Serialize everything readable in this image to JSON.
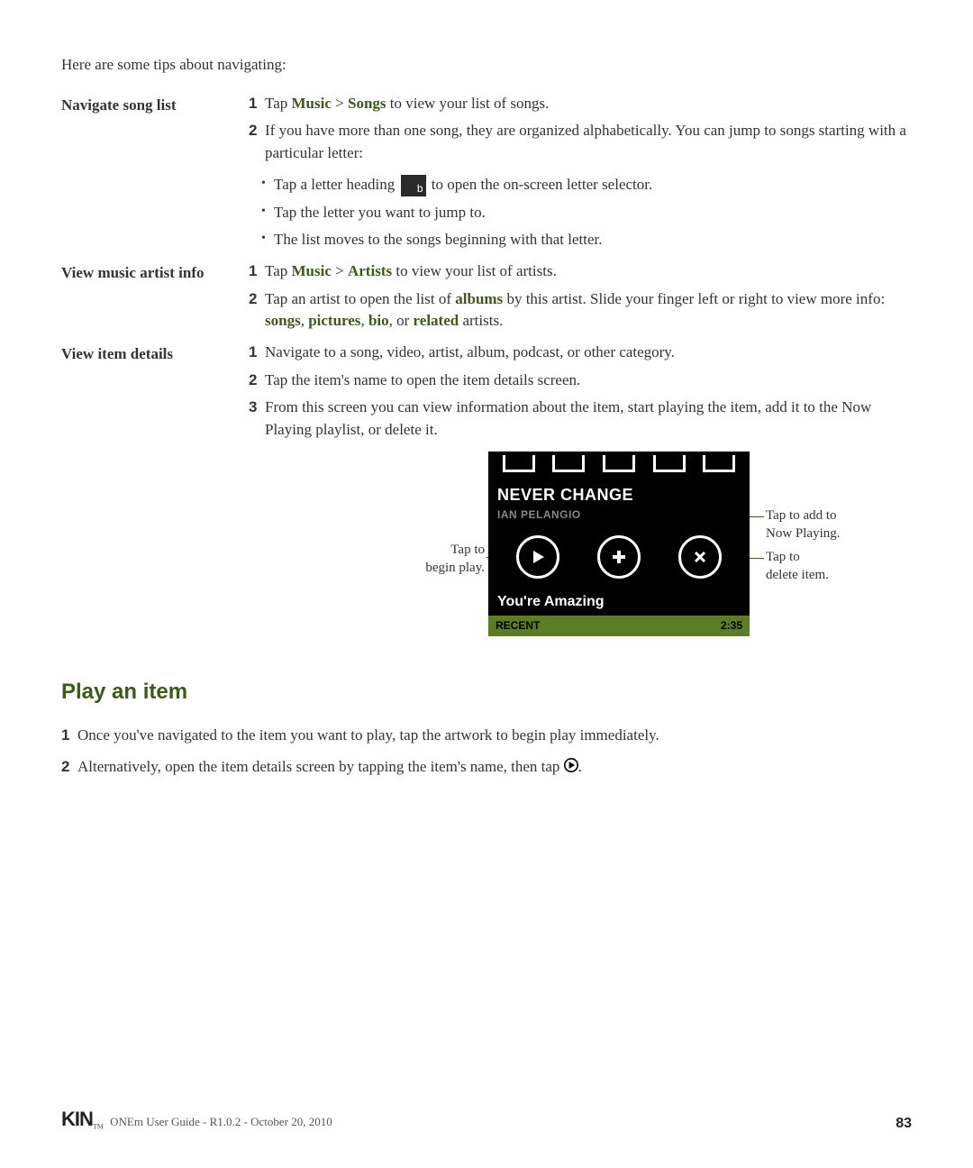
{
  "intro": "Here are some tips about navigating:",
  "rows": {
    "navigate": {
      "label": "Navigate song list",
      "items": {
        "1": {
          "pre": "Tap ",
          "t1": "Music",
          "sep": " > ",
          "t2": "Songs",
          "post": " to view your list of songs."
        },
        "2": "If you have more than one song, they are organized alphabetically. You can jump to songs starting with a particular letter:",
        "b1_pre": "Tap a letter heading ",
        "b1_post": " to open the on-screen letter selector.",
        "b2": "Tap the letter you want to jump to.",
        "b3": "The list moves to the songs beginning with that letter.",
        "b_icon_label": "b"
      }
    },
    "artist": {
      "label": "View music artist info",
      "items": {
        "1": {
          "pre": "Tap ",
          "t1": "Music",
          "sep": " > ",
          "t2": "Artists",
          "post": " to view your list of artists."
        },
        "2_pre": "Tap an artist to open the list of ",
        "2_t1": "albums",
        "2_mid": " by this artist. Slide your finger left or right to view more info: ",
        "2_t2": "songs",
        "2_c1": ", ",
        "2_t3": "pictures",
        "2_c2": ", ",
        "2_t4": "bio",
        "2_c3": ", or ",
        "2_t5": "related",
        "2_post": " artists."
      }
    },
    "details": {
      "label": "View item details",
      "items": {
        "1": "Navigate to a song, video, artist, album, podcast, or other category.",
        "2": "Tap the item's name to open the item details screen.",
        "3": "From this screen you can view information about the item, start playing the item, add it to the Now Playing playlist, or delete it."
      }
    }
  },
  "device": {
    "title": "NEVER CHANGE",
    "artist": "IAN PELANGIO",
    "next_title": "You're Amazing",
    "recent_label": "RECENT",
    "duration": "2:35"
  },
  "callouts": {
    "play_l1": "Tap to",
    "play_l2": "begin play.",
    "add_l1": "Tap to add to",
    "add_l2": "Now Playing.",
    "del_l1": "Tap to",
    "del_l2": "delete item."
  },
  "play_section": {
    "title": "Play an item",
    "1": "Once you've navigated to the item you want to play, tap the artwork to begin play immediately.",
    "2_pre": "Alternatively, open the item details screen by tapping the item's name, then tap ",
    "2_post": "."
  },
  "footer": {
    "logo": "KIN",
    "tm": "TM",
    "text": " ONEm User Guide - R1.0.2 - October 20, 2010",
    "page": "83"
  },
  "numbers": {
    "n1": "1",
    "n2": "2",
    "n3": "3"
  },
  "bullet_char": "•"
}
